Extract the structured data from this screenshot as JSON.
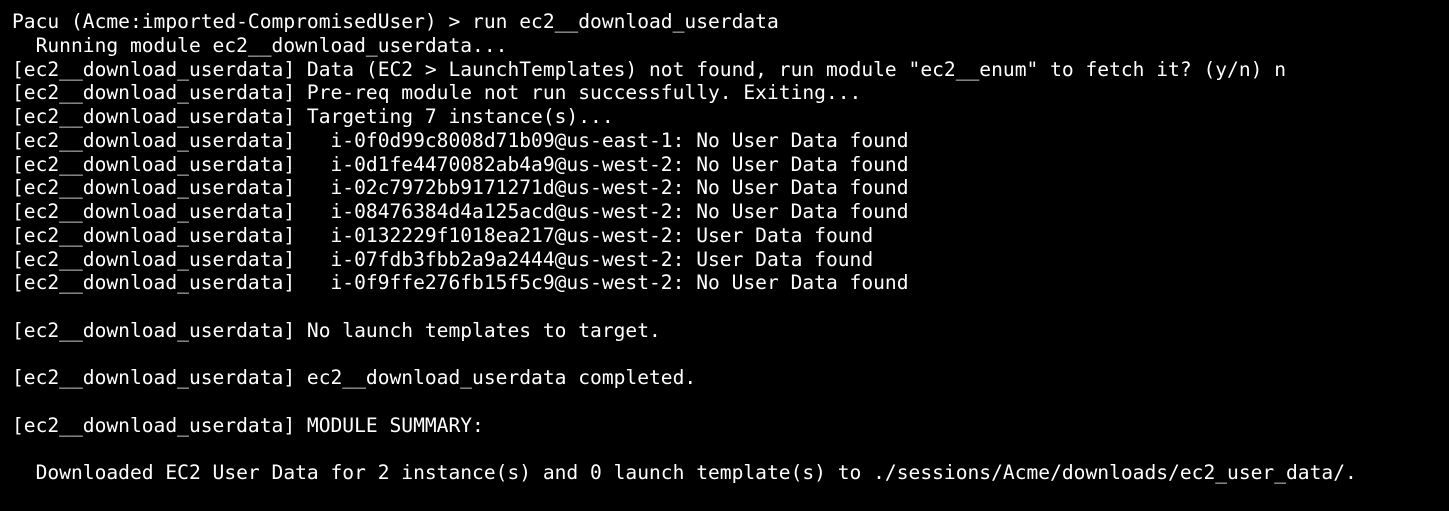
{
  "terminal": {
    "lines": [
      "Pacu (Acme:imported-CompromisedUser) > run ec2__download_userdata",
      "  Running module ec2__download_userdata...",
      "[ec2__download_userdata] Data (EC2 > LaunchTemplates) not found, run module \"ec2__enum\" to fetch it? (y/n) n",
      "[ec2__download_userdata] Pre-req module not run successfully. Exiting...",
      "[ec2__download_userdata] Targeting 7 instance(s)...",
      "[ec2__download_userdata]   i-0f0d99c8008d71b09@us-east-1: No User Data found",
      "[ec2__download_userdata]   i-0d1fe4470082ab4a9@us-west-2: No User Data found",
      "[ec2__download_userdata]   i-02c7972bb9171271d@us-west-2: No User Data found",
      "[ec2__download_userdata]   i-08476384d4a125acd@us-west-2: No User Data found",
      "[ec2__download_userdata]   i-0132229f1018ea217@us-west-2: User Data found",
      "[ec2__download_userdata]   i-07fdb3fbb2a9a2444@us-west-2: User Data found",
      "[ec2__download_userdata]   i-0f9ffe276fb15f5c9@us-west-2: No User Data found",
      "",
      "[ec2__download_userdata] No launch templates to target.",
      "",
      "[ec2__download_userdata] ec2__download_userdata completed.",
      "",
      "[ec2__download_userdata] MODULE SUMMARY:",
      "",
      "  Downloaded EC2 User Data for 2 instance(s) and 0 launch template(s) to ./sessions/Acme/downloads/ec2_user_data/."
    ]
  }
}
